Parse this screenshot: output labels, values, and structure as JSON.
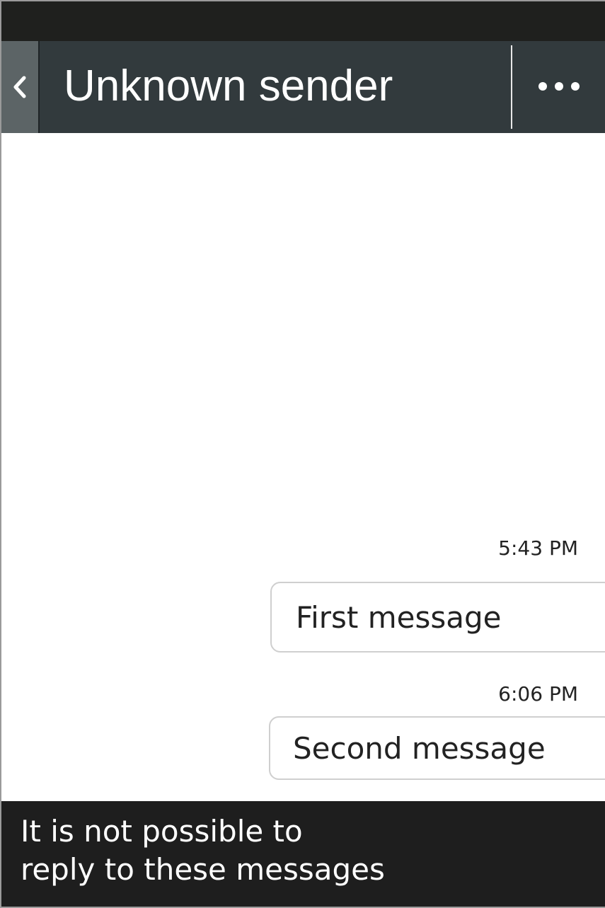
{
  "header": {
    "title": "Unknown sender",
    "back_icon": "chevron-left-icon",
    "more_icon": "more-horizontal-icon"
  },
  "messages": [
    {
      "time": "5:43 PM",
      "text": "First message"
    },
    {
      "time": "6:06 PM",
      "text": "Second message"
    }
  ],
  "footer": {
    "notice_lines": [
      "It is not possible to",
      "reply to these messages"
    ]
  },
  "colors": {
    "status_bar": "#1f201e",
    "header": "#323a3d",
    "back_button": "#5c6466",
    "footer": "#1e1e1e",
    "bubble_border": "#cfcfcf"
  }
}
